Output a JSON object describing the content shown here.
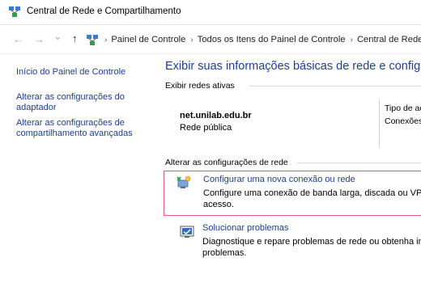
{
  "window": {
    "title": "Central de Rede e Compartilhamento"
  },
  "nav": {
    "back_glyph": "←",
    "forward_glyph": "→",
    "dropdown_glyph": "⌄",
    "up_glyph": "↑",
    "breadcrumbs": [
      "Painel de Controle",
      "Todos os Itens do Painel de Controle",
      "Central de Rede e Co"
    ],
    "sep_glyph": "›"
  },
  "sidebar": {
    "items": [
      {
        "label": "Início do Painel de Controle"
      },
      {
        "label": "Alterar as configurações do adaptador"
      },
      {
        "label": "Alterar as configurações de compartilhamento avançadas"
      }
    ]
  },
  "main": {
    "heading": "Exibir suas informações básicas de rede e configurar",
    "active_section": "Exibir redes ativas",
    "network": {
      "name": "net.unilab.edu.br",
      "type": "Rede pública",
      "col1": "Tipo de ac",
      "col2": "Conexões"
    },
    "change_section": "Alterar as configurações de rede",
    "tasks": [
      {
        "link": "Configurar uma nova conexão ou rede",
        "desc_line1": "Configure uma conexão de banda larga, discada ou VPN; o",
        "desc_line2": "acesso."
      },
      {
        "link": "Solucionar problemas",
        "desc_line1": "Diagnostique e repare problemas de rede ou obtenha infor",
        "desc_line2": "problemas."
      }
    ]
  },
  "colors": {
    "link": "#1a3f8a",
    "heading": "#1e3e96",
    "highlight_border": "#e06070"
  },
  "icons": [
    "network-center-icon",
    "back-icon",
    "forward-icon",
    "dropdown-icon",
    "up-icon",
    "control-panel-icon",
    "new-connection-icon",
    "troubleshoot-icon"
  ]
}
